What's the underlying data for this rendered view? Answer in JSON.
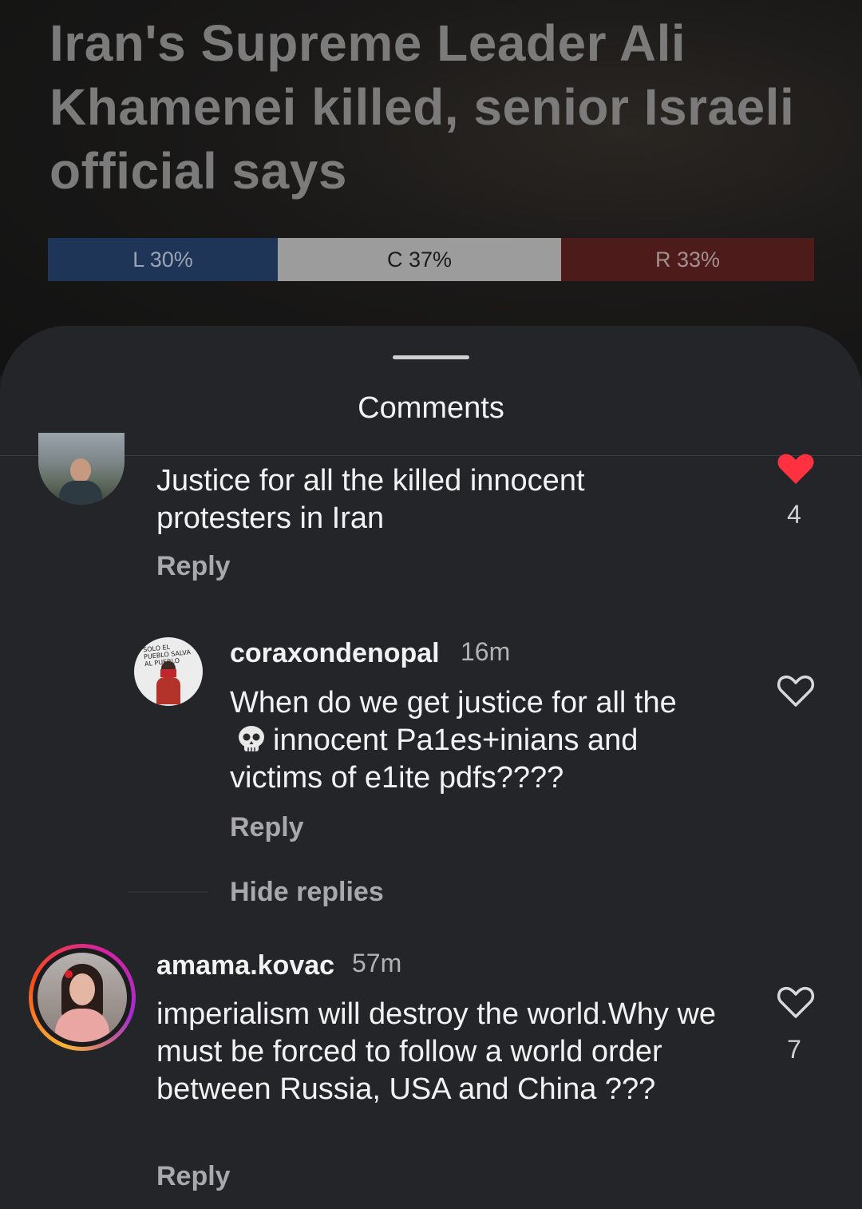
{
  "article": {
    "headline": "Iran's Supreme Leader Ali Khamenei killed, senior Israeli official says",
    "bias": {
      "left_label": "L 30%",
      "center_label": "C 37%",
      "right_label": "R 33%",
      "left_pct": 30,
      "center_pct": 37,
      "right_pct": 33,
      "colors": {
        "left": "#1f3557",
        "center": "#9c9c9c",
        "right": "#4e1b1b"
      }
    }
  },
  "sheet": {
    "title": "Comments"
  },
  "comments": [
    {
      "text": "Justice for all the killed innocent protesters in Iran",
      "reply_label": "Reply",
      "likes": "4",
      "liked": true
    },
    {
      "username": "coraxondenopal",
      "time": "16m",
      "text_before": "When do we get justice for all the",
      "text_after": "innocent Pa1es+inians and victims of e1ite pdfs????",
      "emoji": "skull-emoji",
      "reply_label": "Reply",
      "avatar_text": "SOLO EL PUEBLO SALVA AL PUEBLO",
      "liked": false
    },
    {
      "username": "amama.kovac",
      "time": "57m",
      "text": "imperialism will destroy the world.Why we must be forced to follow a world order between Russia, USA and China ???",
      "reply_label": "Reply",
      "likes": "7",
      "liked": false
    }
  ],
  "thread": {
    "hide_replies_label": "Hide replies"
  },
  "icons": {
    "like_filled": "heart-filled-icon",
    "like_outline": "heart-outline-icon",
    "accent_like": "#ff3040"
  }
}
